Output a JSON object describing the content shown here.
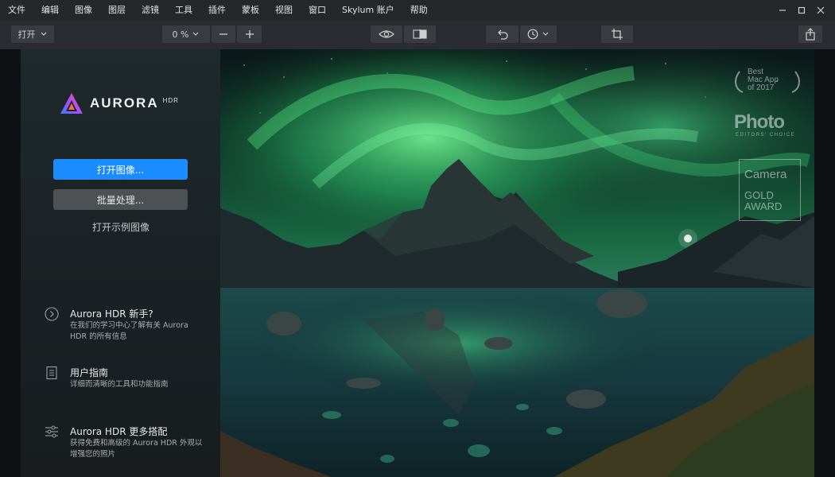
{
  "menu": [
    "文件",
    "编辑",
    "图像",
    "图层",
    "滤镜",
    "工具",
    "插件",
    "蒙板",
    "视图",
    "窗口",
    "Skylum 账户",
    "帮助"
  ],
  "toolbar": {
    "open_label": "打开",
    "zoom_value": "0 %"
  },
  "panel": {
    "logo_text": "AURORA",
    "logo_sup": "HDR",
    "open_image_label": "打开图像...",
    "batch_label": "批量处理...",
    "sample_label": "打开示例图像",
    "help": [
      {
        "title": "Aurora HDR 新手?",
        "desc": "在我们的学习中心了解有关 Aurora HDR 的所有信息",
        "icon": "chevron-circle-icon"
      },
      {
        "title": "用户指南",
        "desc": "详细而清晰的工具和功能指南",
        "icon": "document-icon"
      },
      {
        "title": "Aurora HDR 更多搭配",
        "desc": "获得免费和高级的 Aurora HDR 外观以增强您的照片",
        "icon": "sliders-icon"
      }
    ]
  },
  "awards": {
    "best_app_line1": "Best",
    "best_app_line2": "Mac App",
    "best_app_line3": "of 2017",
    "photo_title": "Photo",
    "photo_sub": "EDITORS' CHOICE",
    "camera_title": "Camera",
    "camera_award1": "GOLD",
    "camera_award2": "AWARD"
  },
  "colors": {
    "accent": "#1a8cff",
    "panel_bg": "#1d2528",
    "menubar_bg": "#26272b",
    "toolbar_bg": "#2b2c31"
  }
}
